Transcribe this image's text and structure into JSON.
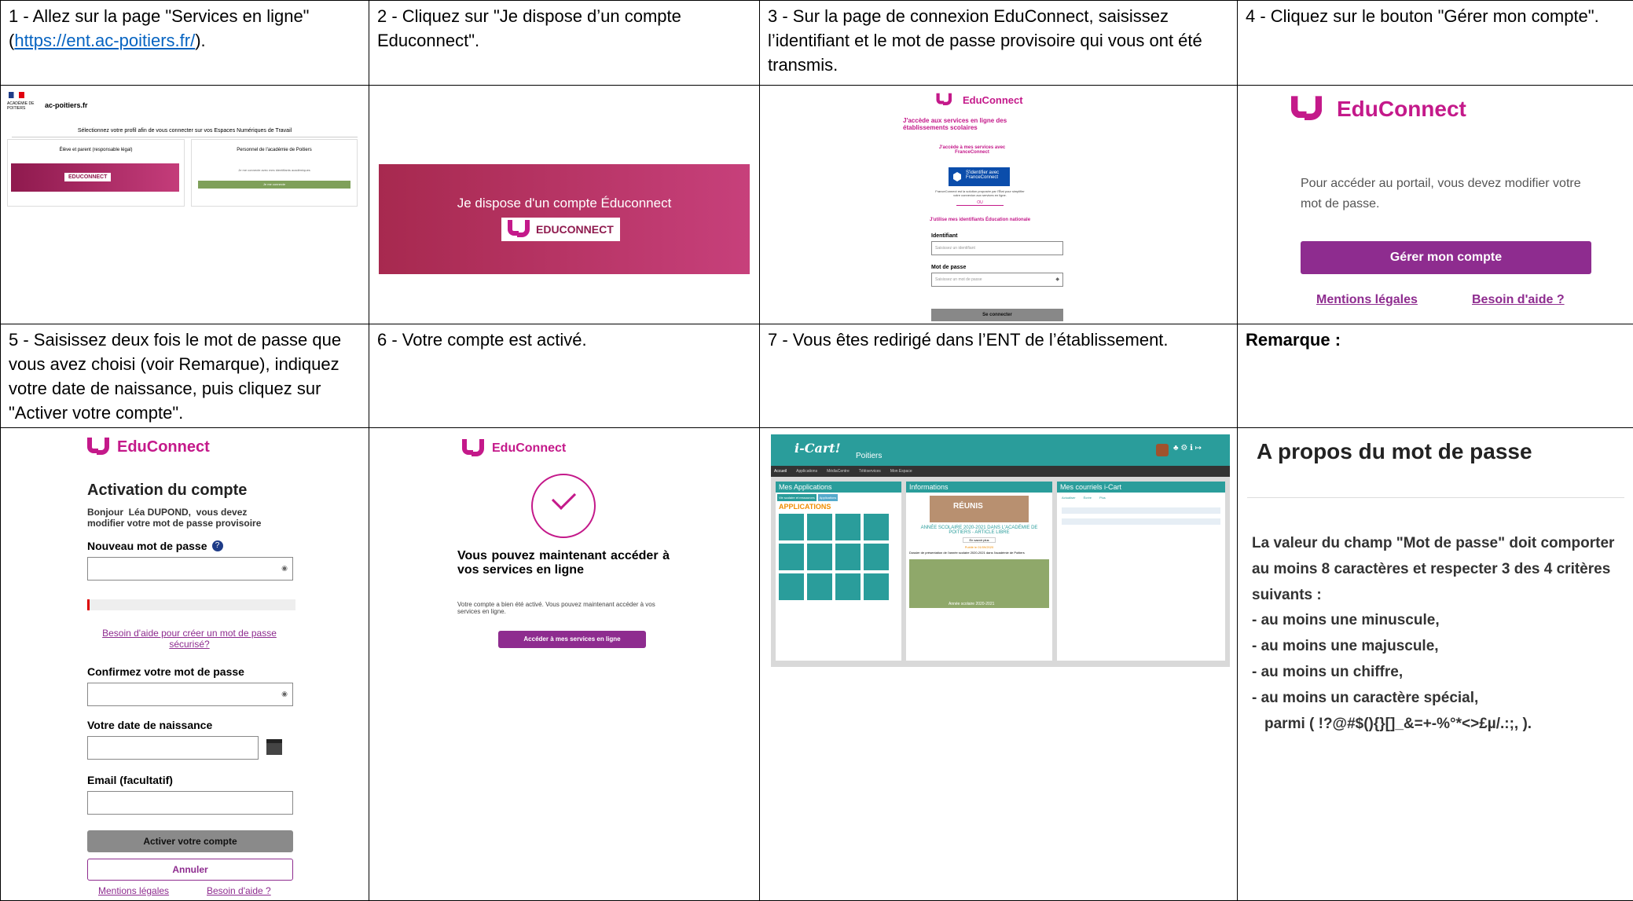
{
  "steps": [
    {
      "text_before": "1 - Allez sur la page \"Services en ligne\" (",
      "link": "https://ent.ac-poitiers.fr/",
      "text_after": ")."
    },
    {
      "text": "2 - Cliquez sur \"Je dispose d’un compte Educonnect\"."
    },
    {
      "text": "3 - Sur la page de connexion EduConnect, saisissez l’identifiant et le mot de passe provisoire qui vous ont été transmis."
    },
    {
      "text": "4 - Cliquez sur le bouton \"Gérer mon compte\"."
    },
    {
      "text": "5 - Saisissez deux fois le mot de passe que vous avez choisi (voir Remarque), indiquez votre date de naissance, puis cliquez sur \"Activer votre compte\"."
    },
    {
      "text": "6 - Votre compte est activé."
    },
    {
      "text": "7 - Vous êtes redirigé dans l’ENT de l’établissement."
    },
    {
      "text": "Remarque :"
    }
  ],
  "shot1": {
    "site": "ac-poitiers.fr",
    "academie": "ACADÉMIE DE POITIERS",
    "heading": "Sélectionnez votre profil afin de vous connecter sur vos Espaces Numériques de Travail",
    "card1_title": "Élève et parent (responsable légal)",
    "card1_button": "EDUCONNECT",
    "card2_title": "Personnel de l'académie de Poitiers",
    "card2_text": "Je me connecte avec mes identifiants académiques",
    "card2_button": "Je me connecte"
  },
  "shot2": {
    "line1": "Je dispose d'un compte Éduconnect",
    "badge": "EDUCONNECT"
  },
  "shot3": {
    "brand": "EduConnect",
    "title": "J'accède aux services en ligne des établissements scolaires",
    "fc_intro": "J'accède à mes services avec FranceConnect",
    "fc_button": "S'identifier avec FranceConnect",
    "fc_note": "FranceConnect est la solution proposée par l'État pour simplifier votre connexion aux services en ligne.",
    "ou": "OU",
    "en_intro": "J'utilise mes identifiants Éducation nationale",
    "id_label": "Identifiant",
    "id_placeholder": "Saisissez un identifiant",
    "pw_label": "Mot de passe",
    "pw_placeholder": "Saisissez un mot de passe",
    "submit": "Se connecter"
  },
  "shot4": {
    "brand": "EduConnect",
    "message": "Pour accéder au portail, vous devez modifier votre mot de passe.",
    "button": "Gérer mon compte",
    "legal": "Mentions légales",
    "help": "Besoin d'aide ?"
  },
  "shot5": {
    "brand": "EduConnect",
    "title": "Activation du compte",
    "greeting": "Bonjour  Léa DUPOND,  vous devez modifier votre mot de passe provisoire",
    "new_pw": "Nouveau mot de passe",
    "help_link": "Besoin d'aide pour créer un mot de passe sécurisé?",
    "confirm_pw": "Confirmez votre mot de passe",
    "birth": "Votre date de naissance",
    "email": "Email (facultatif)",
    "activate": "Activer votre compte",
    "cancel": "Annuler",
    "legal": "Mentions légales",
    "help": "Besoin d'aide ?"
  },
  "shot6": {
    "brand": "EduConnect",
    "heading": "Vous pouvez maintenant accéder à vos services en ligne",
    "text": "Votre compte a bien été activé. Vous pouvez maintenant accéder à vos services en ligne.",
    "button": "Accéder à mes services en ligne"
  },
  "shot7": {
    "brand": "i-Cart!",
    "city": "Poitiers",
    "nav": [
      "Accueil",
      "Applications",
      "MédiaCentre",
      "Téléservices",
      "Mon Espace"
    ],
    "panel1": "Mes Applications",
    "tab1": "Vie scolaire et ressources",
    "tab2": "Applications",
    "apps_heading": "APPLICATIONS",
    "panel2": "Informations",
    "news_badge": "RÉUNIS",
    "news_title": "ANNÉE SCOLAIRE 2020-2021 DANS L'ACADÉMIE DE POITIERS - ARTICLE LIBRE",
    "news_more": "En savoir plus",
    "news_date": "Publié le 01/09/2020",
    "news_desc": "Dossier de présentation de l'année scolaire 2020-2021 dans l'académie de Poitiers",
    "photo_caption": "Année scolaire 2020-2021",
    "panel3": "Mes courriels i-Cart",
    "mail_actions": [
      "Actualiser",
      "Écrire",
      "Plus"
    ]
  },
  "remark": {
    "title": "A propos du mot de passe",
    "intro": "La valeur du champ \"Mot de passe\" doit comporter au moins 8 caractères et respecter 3 des 4 critères suivants :",
    "rules": [
      "- au moins une minuscule,",
      "- au moins une majuscule,",
      "- au moins un chiffre,",
      "- au moins un caractère spécial,"
    ],
    "special": "parmi ( !?@#$(){}[]_&=+-%°*<>£µ/.:;, )."
  },
  "colors": {
    "brand": "#c4198a",
    "button": "#8e2c8f",
    "icart": "#2a9d9b"
  }
}
